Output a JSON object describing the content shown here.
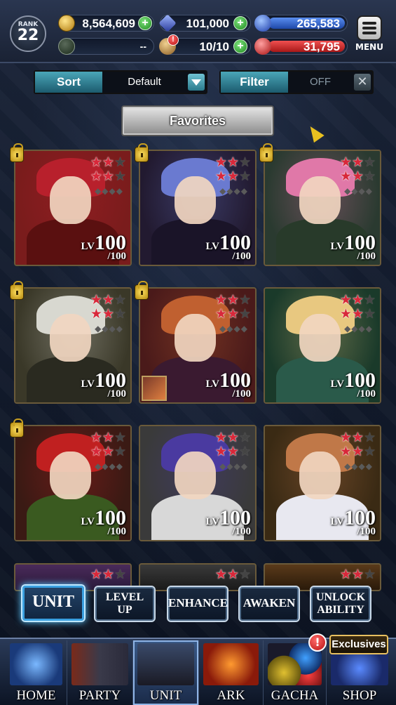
{
  "header": {
    "rank_label": "RANK",
    "rank_value": "22",
    "gold": "8,564,609",
    "crystals": "101,000",
    "blue_orbs": "265,583",
    "empty_stat": "--",
    "stamina": "10/10",
    "red_orbs": "31,795",
    "menu_label": "MENU",
    "colors": {
      "blue_bar": "#2e6ad8",
      "red_bar": "#d02a2a",
      "plus_green": "#2fa52f"
    }
  },
  "controls": {
    "sort_label": "Sort",
    "sort_value": "Default",
    "filter_label": "Filter",
    "filter_value": "OFF",
    "favorites_label": "Favorites"
  },
  "units": [
    {
      "level": "100",
      "max": "/100",
      "locked": true,
      "stars": 3,
      "colors": [
        "#7a1c1c",
        "#b8202c",
        "#5a1010"
      ]
    },
    {
      "level": "100",
      "max": "/100",
      "locked": true,
      "stars": 3,
      "colors": [
        "#221a30",
        "#6a7ad0",
        "#1a1428"
      ]
    },
    {
      "level": "100",
      "max": "/100",
      "locked": true,
      "stars": 3,
      "colors": [
        "#2a3a30",
        "#e078a8",
        "#283a2a"
      ]
    },
    {
      "level": "100",
      "max": "/100",
      "locked": true,
      "stars": 3,
      "colors": [
        "#3a3828",
        "#d8d8d0",
        "#2a2a20"
      ]
    },
    {
      "level": "100",
      "max": "/100",
      "locked": true,
      "stars": 3,
      "colors": [
        "#4a1a1a",
        "#c06030",
        "#3a1a30"
      ]
    },
    {
      "level": "100",
      "max": "/100",
      "locked": false,
      "stars": 3,
      "colors": [
        "#1a3a2a",
        "#e8c880",
        "#2a5a4a"
      ]
    },
    {
      "level": "100",
      "max": "/100",
      "locked": true,
      "stars": 3,
      "colors": [
        "#3a1a14",
        "#c02020",
        "#3a5a20"
      ]
    },
    {
      "level": "100",
      "max": "/100",
      "locked": false,
      "stars": 3,
      "colors": [
        "#3a3a3a",
        "#4a3aa0",
        "#d8d8d8"
      ]
    },
    {
      "level": "100",
      "max": "/100",
      "locked": false,
      "stars": 3,
      "colors": [
        "#3a2a14",
        "#c07848",
        "#e8e8f0"
      ]
    }
  ],
  "lv_label": "LV",
  "actions": {
    "unit": "UNIT",
    "level_up_1": "LEVEL",
    "level_up_2": "UP",
    "enhance": "ENHANCE",
    "awaken": "AWAKEN",
    "unlock_1": "UNLOCK",
    "unlock_2": "ABILITY"
  },
  "tabs": {
    "home": "HOME",
    "party": "PARTY",
    "unit": "UNIT",
    "ark": "ARK",
    "gacha": "GACHA",
    "shop": "SHOP",
    "exclusives": "Exclusives",
    "gacha_badge": "!"
  }
}
